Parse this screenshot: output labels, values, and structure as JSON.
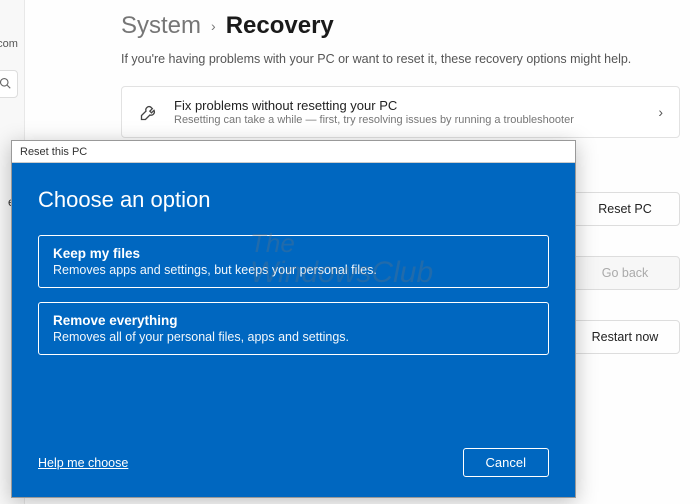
{
  "breadcrumb": {
    "parent": "System",
    "current": "Recovery"
  },
  "subhead": "If you're having problems with your PC or want to reset it, these recovery options might help.",
  "left_hint": "ive.com",
  "left_snip": "et",
  "fix_card": {
    "title": "Fix problems without resetting your PC",
    "subtitle": "Resetting can take a while — first, try resolving issues by running a troubleshooter"
  },
  "side_buttons": {
    "reset": "Reset PC",
    "goback": "Go back",
    "restart": "Restart now"
  },
  "dialog": {
    "titlebar": "Reset this PC",
    "heading": "Choose an option",
    "option1": {
      "title": "Keep my files",
      "desc": "Removes apps and settings, but keeps your personal files."
    },
    "option2": {
      "title": "Remove everything",
      "desc": "Removes all of your personal files, apps and settings."
    },
    "help": "Help me choose",
    "cancel": "Cancel"
  },
  "watermark": {
    "l1": "The",
    "l2": "WindowsClub"
  }
}
